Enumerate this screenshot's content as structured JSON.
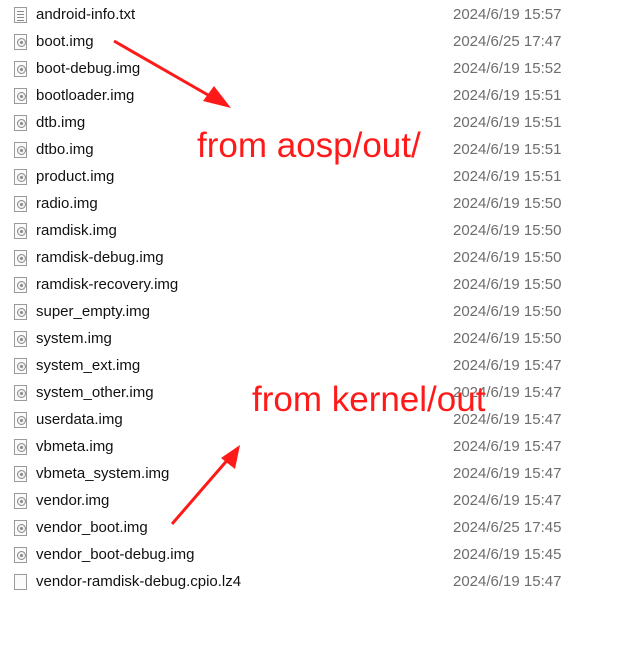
{
  "files": [
    {
      "name": "android-info.txt",
      "date": "2024/6/19 15:57",
      "icon": "text-file-icon"
    },
    {
      "name": "boot.img",
      "date": "2024/6/25 17:47",
      "icon": "disc-image-icon"
    },
    {
      "name": "boot-debug.img",
      "date": "2024/6/19 15:52",
      "icon": "disc-image-icon"
    },
    {
      "name": "bootloader.img",
      "date": "2024/6/19 15:51",
      "icon": "disc-image-icon"
    },
    {
      "name": "dtb.img",
      "date": "2024/6/19 15:51",
      "icon": "disc-image-icon"
    },
    {
      "name": "dtbo.img",
      "date": "2024/6/19 15:51",
      "icon": "disc-image-icon"
    },
    {
      "name": "product.img",
      "date": "2024/6/19 15:51",
      "icon": "disc-image-icon"
    },
    {
      "name": "radio.img",
      "date": "2024/6/19 15:50",
      "icon": "disc-image-icon"
    },
    {
      "name": "ramdisk.img",
      "date": "2024/6/19 15:50",
      "icon": "disc-image-icon"
    },
    {
      "name": "ramdisk-debug.img",
      "date": "2024/6/19 15:50",
      "icon": "disc-image-icon"
    },
    {
      "name": "ramdisk-recovery.img",
      "date": "2024/6/19 15:50",
      "icon": "disc-image-icon"
    },
    {
      "name": "super_empty.img",
      "date": "2024/6/19 15:50",
      "icon": "disc-image-icon"
    },
    {
      "name": "system.img",
      "date": "2024/6/19 15:50",
      "icon": "disc-image-icon"
    },
    {
      "name": "system_ext.img",
      "date": "2024/6/19 15:47",
      "icon": "disc-image-icon"
    },
    {
      "name": "system_other.img",
      "date": "2024/6/19 15:47",
      "icon": "disc-image-icon"
    },
    {
      "name": "userdata.img",
      "date": "2024/6/19 15:47",
      "icon": "disc-image-icon"
    },
    {
      "name": "vbmeta.img",
      "date": "2024/6/19 15:47",
      "icon": "disc-image-icon"
    },
    {
      "name": "vbmeta_system.img",
      "date": "2024/6/19 15:47",
      "icon": "disc-image-icon"
    },
    {
      "name": "vendor.img",
      "date": "2024/6/19 15:47",
      "icon": "disc-image-icon"
    },
    {
      "name": "vendor_boot.img",
      "date": "2024/6/25 17:45",
      "icon": "disc-image-icon"
    },
    {
      "name": "vendor_boot-debug.img",
      "date": "2024/6/19 15:45",
      "icon": "disc-image-icon"
    },
    {
      "name": "vendor-ramdisk-debug.cpio.lz4",
      "date": "2024/6/19 15:47",
      "icon": "blank-file-icon"
    }
  ],
  "annotations": {
    "aosp_label": "from aosp/out/",
    "kernel_label": "from kernel/out",
    "color": "#ff1a1a"
  }
}
